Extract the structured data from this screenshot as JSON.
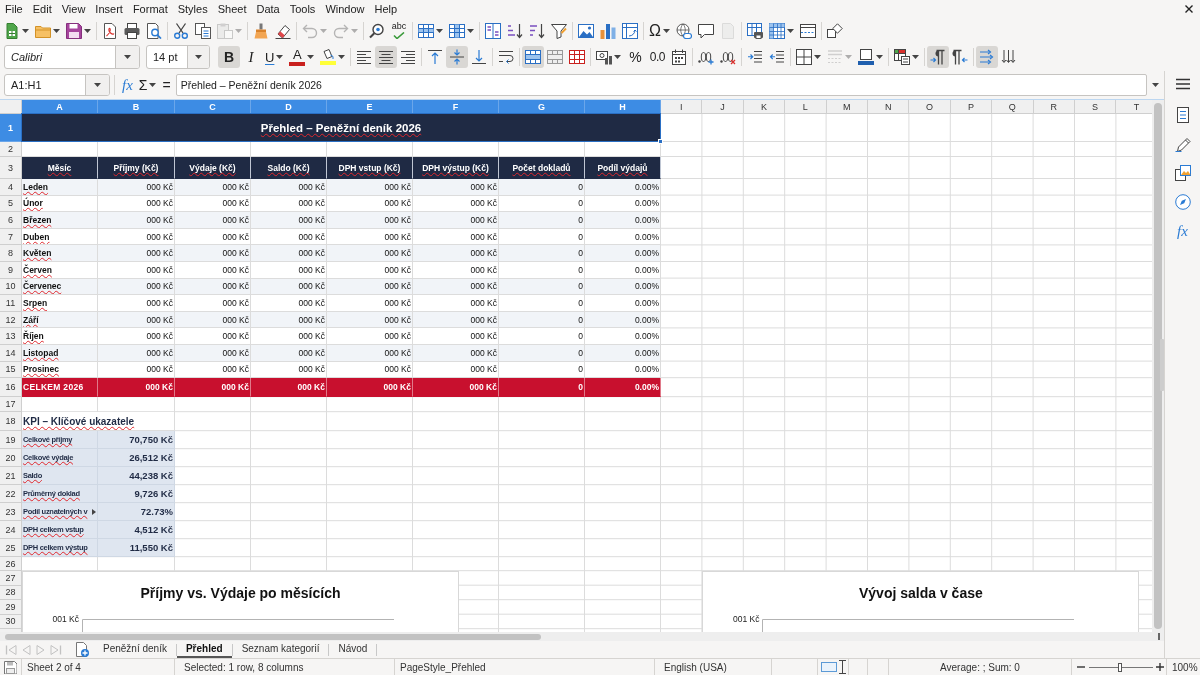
{
  "menu_bar": [
    "File",
    "Edit",
    "View",
    "Insert",
    "Format",
    "Styles",
    "Sheet",
    "Data",
    "Tools",
    "Window",
    "Help"
  ],
  "standard_toolbar": [
    [
      {
        "kind": "new",
        "disabled": false
      },
      {
        "kind": "open",
        "disabled": false
      },
      {
        "kind": "save",
        "disabled": false
      }
    ],
    [
      {
        "kind": "export_pdf",
        "disabled": false
      },
      {
        "kind": "print",
        "disabled": false
      },
      {
        "kind": "print_preview",
        "disabled": false
      }
    ],
    [
      {
        "kind": "cut",
        "disabled": false
      },
      {
        "kind": "copy",
        "disabled": false
      },
      {
        "kind": "paste",
        "disabled": true
      }
    ],
    [
      {
        "kind": "clone_formatting",
        "disabled": false
      },
      {
        "kind": "clear_formatting",
        "disabled": false
      }
    ],
    [
      {
        "kind": "undo",
        "disabled": true
      },
      {
        "kind": "redo",
        "disabled": true
      }
    ],
    [
      {
        "kind": "find_replace",
        "disabled": false
      },
      {
        "kind": "spelling",
        "label": "abc",
        "disabled": false
      }
    ],
    [
      {
        "kind": "row",
        "disabled": false
      },
      {
        "kind": "column",
        "disabled": false
      }
    ],
    [
      {
        "kind": "sort",
        "disabled": false
      },
      {
        "kind": "sort_ascending",
        "disabled": false
      },
      {
        "kind": "sort_descending",
        "disabled": false
      },
      {
        "kind": "autofilter",
        "disabled": false
      }
    ],
    [
      {
        "kind": "image",
        "disabled": false
      },
      {
        "kind": "chart",
        "disabled": false
      },
      {
        "kind": "pivot_table",
        "disabled": false
      }
    ],
    [
      {
        "kind": "special_character",
        "label": "Ω",
        "disabled": false
      },
      {
        "kind": "hyperlink",
        "disabled": false
      },
      {
        "kind": "comment",
        "disabled": false
      },
      {
        "kind": "header_footer",
        "disabled": true
      }
    ],
    [
      {
        "kind": "print_area",
        "disabled": false
      },
      {
        "kind": "freeze",
        "disabled": false
      },
      {
        "kind": "split_window",
        "disabled": false
      }
    ],
    [
      {
        "kind": "shapes",
        "disabled": false
      }
    ]
  ],
  "formatting_toolbar": {
    "font_name": "Calibri",
    "font_size": "14 pt",
    "groups": [
      [
        {
          "kind": "bold",
          "label": "B",
          "on": true,
          "disabled": false
        },
        {
          "kind": "italic",
          "label": "I",
          "on": false,
          "disabled": false
        },
        {
          "kind": "underline",
          "label": "U",
          "on": false,
          "disabled": false
        },
        {
          "kind": "font_color",
          "label": "A",
          "on": false,
          "disabled": false
        },
        {
          "kind": "highlight",
          "on": false,
          "disabled": false
        }
      ],
      [
        {
          "kind": "align_left",
          "on": false,
          "disabled": false
        },
        {
          "kind": "align_center",
          "on": true,
          "disabled": false
        },
        {
          "kind": "align_right",
          "on": false,
          "disabled": false
        }
      ],
      [
        {
          "kind": "align_top",
          "on": false,
          "disabled": false
        },
        {
          "kind": "align_middle",
          "on": true,
          "disabled": false
        },
        {
          "kind": "align_bottom",
          "on": false,
          "disabled": false
        }
      ],
      [
        {
          "kind": "wrap",
          "on": false,
          "disabled": false
        }
      ],
      [
        {
          "kind": "merge_center",
          "on": true,
          "disabled": false
        },
        {
          "kind": "merge",
          "on": false,
          "disabled": false
        },
        {
          "kind": "unmerge",
          "on": false,
          "disabled": false
        }
      ],
      [
        {
          "kind": "currency",
          "on": false,
          "disabled": false
        },
        {
          "kind": "percent",
          "label": "%",
          "on": false,
          "disabled": false
        },
        {
          "kind": "number",
          "label": "0.0",
          "on": false,
          "disabled": false
        },
        {
          "kind": "date",
          "on": false,
          "disabled": false
        }
      ],
      [
        {
          "kind": "add_decimal",
          "on": false,
          "disabled": false
        },
        {
          "kind": "delete_decimal",
          "on": false,
          "disabled": false
        }
      ],
      [
        {
          "kind": "indent_increase",
          "on": false,
          "disabled": false
        },
        {
          "kind": "indent_decrease",
          "on": false,
          "disabled": false
        }
      ],
      [
        {
          "kind": "borders",
          "on": false,
          "disabled": false
        },
        {
          "kind": "border_style",
          "on": false,
          "disabled": true
        },
        {
          "kind": "border_color",
          "on": false,
          "disabled": false
        }
      ],
      [
        {
          "kind": "conditional",
          "on": false,
          "disabled": false
        }
      ],
      [
        {
          "kind": "paragraph_ltr",
          "on": true,
          "disabled": false
        },
        {
          "kind": "paragraph_rtl",
          "on": false,
          "disabled": false
        }
      ],
      [
        {
          "kind": "text_ltr",
          "on": true,
          "disabled": false
        },
        {
          "kind": "text_vertical",
          "on": false,
          "disabled": false
        }
      ]
    ]
  },
  "formula_bar": {
    "name_box": "A1:H1",
    "buttons": [
      {
        "kind": "function_wizard",
        "label": "fx"
      },
      {
        "kind": "sum",
        "label": "Σ"
      },
      {
        "kind": "formula",
        "label": "="
      }
    ],
    "content": "Přehled – Peněžní deník 2026"
  },
  "sheet": {
    "autospell": true,
    "columns": [
      {
        "label": "A",
        "selected": true
      },
      {
        "label": "B",
        "selected": true
      },
      {
        "label": "C",
        "selected": true
      },
      {
        "label": "D",
        "selected": true
      },
      {
        "label": "E",
        "selected": true
      },
      {
        "label": "F",
        "selected": true
      },
      {
        "label": "G",
        "selected": true
      },
      {
        "label": "H",
        "selected": true
      },
      {
        "label": "I",
        "selected": false
      },
      {
        "label": "J",
        "selected": false
      },
      {
        "label": "K",
        "selected": false
      },
      {
        "label": "L",
        "selected": false
      },
      {
        "label": "M",
        "selected": false
      },
      {
        "label": "N",
        "selected": false
      },
      {
        "label": "O",
        "selected": false
      },
      {
        "label": "P",
        "selected": false
      },
      {
        "label": "Q",
        "selected": false
      },
      {
        "label": "R",
        "selected": false
      },
      {
        "label": "S",
        "selected": false
      },
      {
        "label": "T",
        "selected": false
      }
    ],
    "rows": [
      {
        "label": "1",
        "selected": true
      },
      {
        "label": "2",
        "selected": false
      },
      {
        "label": "3",
        "selected": false
      },
      {
        "label": "4",
        "selected": false
      },
      {
        "label": "5",
        "selected": false
      },
      {
        "label": "6",
        "selected": false
      },
      {
        "label": "7",
        "selected": false
      },
      {
        "label": "8",
        "selected": false
      },
      {
        "label": "9",
        "selected": false
      },
      {
        "label": "10",
        "selected": false
      },
      {
        "label": "11",
        "selected": false
      },
      {
        "label": "12",
        "selected": false
      },
      {
        "label": "13",
        "selected": false
      },
      {
        "label": "14",
        "selected": false
      },
      {
        "label": "15",
        "selected": false
      },
      {
        "label": "16",
        "selected": false
      },
      {
        "label": "17",
        "selected": false
      },
      {
        "label": "18",
        "selected": false
      },
      {
        "label": "19",
        "selected": false
      },
      {
        "label": "20",
        "selected": false
      },
      {
        "label": "21",
        "selected": false
      },
      {
        "label": "22",
        "selected": false
      },
      {
        "label": "23",
        "selected": false
      },
      {
        "label": "24",
        "selected": false
      },
      {
        "label": "25",
        "selected": false
      },
      {
        "label": "26",
        "selected": false
      },
      {
        "label": "27",
        "selected": false
      },
      {
        "label": "28",
        "selected": false
      },
      {
        "label": "29",
        "selected": false
      },
      {
        "label": "30",
        "selected": false
      }
    ],
    "title": "Přehled – Peněžní deník 2026",
    "table": {
      "headers": [
        "Měsíc",
        "Příjmy (Kč)",
        "Výdaje (Kč)",
        "Saldo (Kč)",
        "DPH vstup (Kč)",
        "DPH výstup (Kč)",
        "Počet dokladů",
        "Podíl výdajů"
      ],
      "rows": [
        [
          "Leden",
          "000 Kč",
          "000 Kč",
          "000 Kč",
          "000 Kč",
          "000 Kč",
          "0",
          "0.00%"
        ],
        [
          "Únor",
          "000 Kč",
          "000 Kč",
          "000 Kč",
          "000 Kč",
          "000 Kč",
          "0",
          "0.00%"
        ],
        [
          "Březen",
          "000 Kč",
          "000 Kč",
          "000 Kč",
          "000 Kč",
          "000 Kč",
          "0",
          "0.00%"
        ],
        [
          "Duben",
          "000 Kč",
          "000 Kč",
          "000 Kč",
          "000 Kč",
          "000 Kč",
          "0",
          "0.00%"
        ],
        [
          "Květen",
          "000 Kč",
          "000 Kč",
          "000 Kč",
          "000 Kč",
          "000 Kč",
          "0",
          "0.00%"
        ],
        [
          "Červen",
          "000 Kč",
          "000 Kč",
          "000 Kč",
          "000 Kč",
          "000 Kč",
          "0",
          "0.00%"
        ],
        [
          "Červenec",
          "000 Kč",
          "000 Kč",
          "000 Kč",
          "000 Kč",
          "000 Kč",
          "0",
          "0.00%"
        ],
        [
          "Srpen",
          "000 Kč",
          "000 Kč",
          "000 Kč",
          "000 Kč",
          "000 Kč",
          "0",
          "0.00%"
        ],
        [
          "Září",
          "000 Kč",
          "000 Kč",
          "000 Kč",
          "000 Kč",
          "000 Kč",
          "0",
          "0.00%"
        ],
        [
          "Říjen",
          "000 Kč",
          "000 Kč",
          "000 Kč",
          "000 Kč",
          "000 Kč",
          "0",
          "0.00%"
        ],
        [
          "Listopad",
          "000 Kč",
          "000 Kč",
          "000 Kč",
          "000 Kč",
          "000 Kč",
          "0",
          "0.00%"
        ],
        [
          "Prosinec",
          "000 Kč",
          "000 Kč",
          "000 Kč",
          "000 Kč",
          "000 Kč",
          "0",
          "0.00%"
        ]
      ],
      "total": [
        "CELKEM 2026",
        "000 Kč",
        "000 Kč",
        "000 Kč",
        "000 Kč",
        "000 Kč",
        "0",
        "0.00%"
      ]
    },
    "kpi": {
      "title": "KPI – Klíčové ukazatele",
      "items": [
        {
          "label": "Celkové příjmy",
          "value": "70,750 Kč",
          "clipped": false
        },
        {
          "label": "Celkové výdaje",
          "value": "26,512 Kč",
          "clipped": false
        },
        {
          "label": "Saldo",
          "value": "44,238 Kč",
          "clipped": false
        },
        {
          "label": "Průměrný doklad",
          "value": "9,726 Kč",
          "clipped": false
        },
        {
          "label": "Podíl uznatelných v",
          "value": "72.73%",
          "clipped": true
        },
        {
          "label": "DPH celkem vstup",
          "value": "4,512 Kč",
          "clipped": false
        },
        {
          "label": "DPH celkem výstup",
          "value": "11,550 Kč",
          "clipped": false
        }
      ]
    },
    "charts": [
      {
        "title": "Příjmy vs. Výdaje po měsících",
        "axis_label": "001 Kč"
      },
      {
        "title": "Vývoj salda v čase",
        "axis_label": "001 Kč"
      }
    ]
  },
  "sheet_tabs": {
    "navigation": [
      {
        "kind": "first",
        "disabled": true
      },
      {
        "kind": "previous",
        "disabled": true
      },
      {
        "kind": "next",
        "disabled": true
      },
      {
        "kind": "last",
        "disabled": true
      }
    ],
    "tabs": [
      {
        "label": "Peněžní deník",
        "selected": false
      },
      {
        "label": "Přehled",
        "selected": true
      },
      {
        "label": "Seznam kategorií",
        "selected": false
      },
      {
        "label": "Návod",
        "selected": false
      }
    ]
  },
  "sidebar": {
    "tabs": [
      {
        "kind": "properties",
        "selected": false
      },
      {
        "kind": "styles",
        "selected": false
      },
      {
        "kind": "gallery",
        "selected": false
      },
      {
        "kind": "navigator",
        "selected": false
      },
      {
        "kind": "functions",
        "label": "fx",
        "selected": false
      }
    ]
  },
  "status_bar": {
    "sheet_position": "Sheet 2 of 4",
    "selection": "Selected: 1 row, 8 columns",
    "page_style": "PageStyle_Přehled",
    "language": "English (USA)",
    "summary": "Average: ; Sum: 0",
    "zoom": {
      "level": 0.48,
      "reading": "100%"
    }
  }
}
